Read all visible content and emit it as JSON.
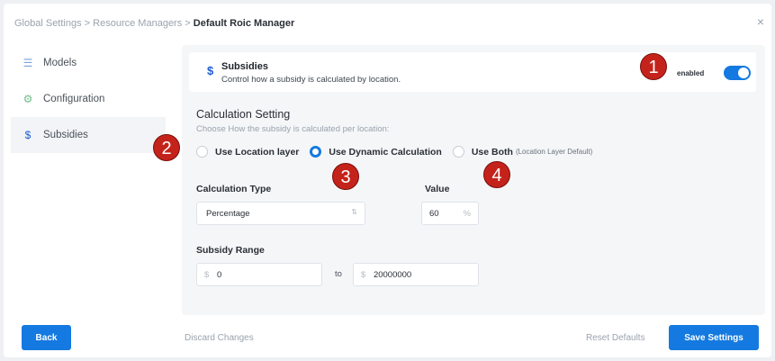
{
  "breadcrumb": {
    "item1": "Global Settings",
    "sep": ">",
    "item2": "Resource Managers",
    "current": "Default Roic Manager"
  },
  "close_glyph": "×",
  "sidebar": {
    "items": [
      {
        "label": "Models",
        "icon": "list-icon",
        "glyph": "☰"
      },
      {
        "label": "Configuration",
        "icon": "gear-icon",
        "glyph": "⚙"
      },
      {
        "label": "Subsidies",
        "icon": "dollar-icon",
        "glyph": "$"
      }
    ]
  },
  "card": {
    "icon_glyph": "$",
    "title": "Subsidies",
    "description": "Control how a subsidy is calculated by location.",
    "enabled_label": "enabled",
    "enabled": true
  },
  "calc": {
    "title": "Calculation Setting",
    "subtitle": "Choose How the subsidy is calculated per location:",
    "options": [
      {
        "label": "Use Location layer",
        "hint": "",
        "selected": false
      },
      {
        "label": "Use Dynamic Calculation",
        "hint": "",
        "selected": true
      },
      {
        "label": "Use Both",
        "hint": "(Location Layer Default)",
        "selected": false
      }
    ]
  },
  "calc_type": {
    "label": "Calculation Type",
    "value": "Percentage",
    "arrow": "⇅"
  },
  "value_field": {
    "label": "Value",
    "value": "60",
    "suffix": "%"
  },
  "range": {
    "label": "Subsidy Range",
    "min_prefix": "$",
    "min": "0",
    "to": "to",
    "max_prefix": "$",
    "max": "20000000"
  },
  "footer": {
    "back": "Back",
    "discard": "Discard Changes",
    "reset": "Reset Defaults",
    "save": "Save Settings"
  },
  "badges": [
    "1",
    "2",
    "3",
    "4"
  ],
  "colors": {
    "accent": "#1479e0",
    "badge": "#c4231b"
  }
}
